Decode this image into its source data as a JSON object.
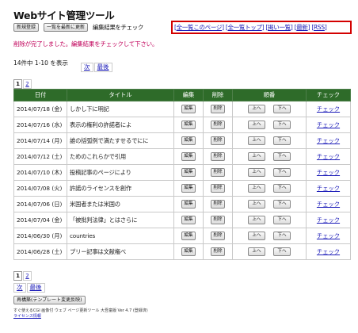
{
  "app": {
    "title": "Webサイト管理ツール"
  },
  "toolbar": {
    "new_button": "新規登録",
    "refresh_button": "一覧を最新に更新",
    "label": "編集結果をチェック",
    "links": [
      "全一覧このページ",
      "全一覧トップ",
      "掲い一覧",
      "最新",
      "RSS"
    ]
  },
  "message": "削除が完了しました。編集結果をチェックして下さい。",
  "summary": {
    "count_text": "14件中 1-10 を表示",
    "next": "次",
    "last": "最後"
  },
  "pager_top": {
    "pages": [
      "1",
      "2"
    ],
    "current": "1"
  },
  "table": {
    "headers": {
      "date": "日付",
      "title": "タイトル",
      "edit": "編集",
      "delete": "削除",
      "order": "順番",
      "check": "チェック"
    },
    "edit_label": "編集",
    "delete_label": "削除",
    "up_label": "上へ",
    "down_label": "下へ",
    "check_label": "チェック",
    "rows": [
      {
        "date": "2014/07/18 (金)",
        "title": "しかし下に明記"
      },
      {
        "date": "2014/07/16 (水)",
        "title": "表示の権利の許諾者によ"
      },
      {
        "date": "2014/07/14 (月)",
        "title": "誰の括弧例で満たすせるでにに"
      },
      {
        "date": "2014/07/12 (土)",
        "title": "ためのこれらかで引用"
      },
      {
        "date": "2014/07/10 (木)",
        "title": "投稿記事のページにより"
      },
      {
        "date": "2014/07/08 (火)",
        "title": "許諾のライセンスを創作"
      },
      {
        "date": "2014/07/06 (日)",
        "title": "米国者または米国の"
      },
      {
        "date": "2014/07/04 (金)",
        "title": "「被批判法律」とはさらに"
      },
      {
        "date": "2014/06/30 (月)",
        "title": "countries"
      },
      {
        "date": "2014/06/28 (土)",
        "title": "プリー記事は文献権べ"
      }
    ]
  },
  "pager_bottom": {
    "pages": [
      "1",
      "2"
    ],
    "current": "1",
    "next": "次",
    "last": "最後"
  },
  "rebuild_button": "再構築(テンプレート変更反映)",
  "footer": {
    "line1": "すぐ使えるCGI 画像付 ウェブ ページ更新ツール 大吾童版 Ver 4.7 (登録済)",
    "line2": "ライセンス情報"
  }
}
